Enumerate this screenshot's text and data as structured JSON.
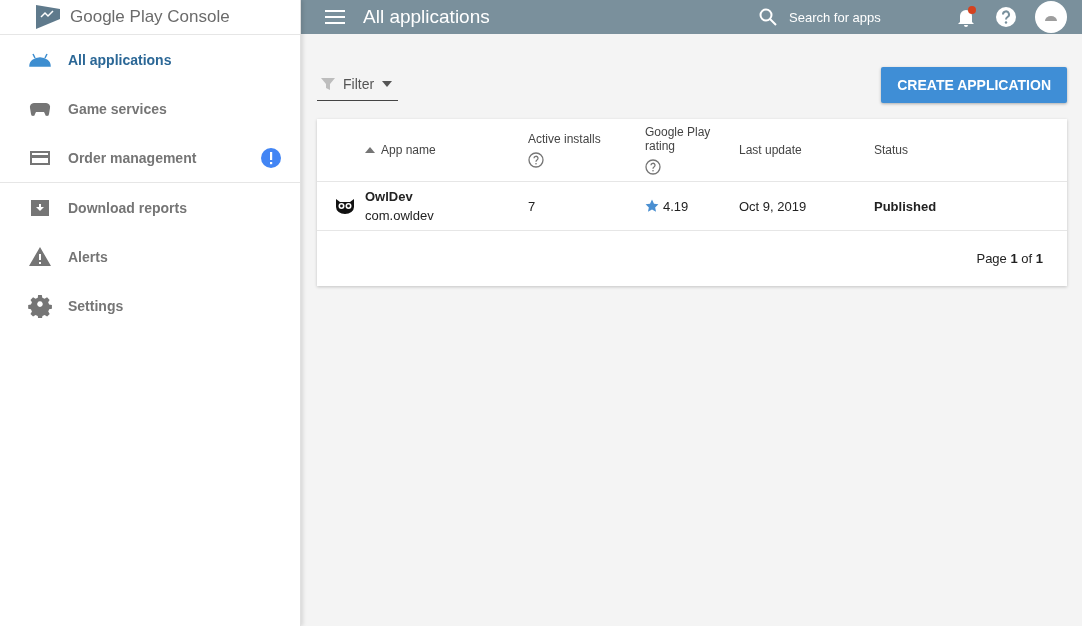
{
  "logo": {
    "text": "Google Play Console"
  },
  "sidebar": {
    "items": [
      {
        "label": "All applications",
        "kind": "android",
        "selected": true,
        "badge": false,
        "divider_after": false
      },
      {
        "label": "Game services",
        "kind": "gamepad",
        "selected": false,
        "badge": false,
        "divider_after": false
      },
      {
        "label": "Order management",
        "kind": "card",
        "selected": false,
        "badge": true,
        "divider_after": true
      },
      {
        "label": "Download reports",
        "kind": "download",
        "selected": false,
        "badge": false,
        "divider_after": false
      },
      {
        "label": "Alerts",
        "kind": "alert",
        "selected": false,
        "badge": false,
        "divider_after": false
      },
      {
        "label": "Settings",
        "kind": "gear",
        "selected": false,
        "badge": false,
        "divider_after": false
      }
    ]
  },
  "topbar": {
    "title": "All applications",
    "search_placeholder": "Search for apps",
    "notification": true
  },
  "filter": {
    "label": "Filter"
  },
  "create_button": "CREATE APPLICATION",
  "table": {
    "columns": [
      {
        "label": "App name",
        "sort": true,
        "help": false
      },
      {
        "label": "Active installs",
        "sort": false,
        "help": true
      },
      {
        "label": "Google Play rating",
        "sort": false,
        "help": true
      },
      {
        "label": "Last update",
        "sort": false,
        "help": false
      },
      {
        "label": "Status",
        "sort": false,
        "help": false
      }
    ],
    "rows": [
      {
        "name": "OwlDev",
        "package": "com.owldev",
        "installs": "7",
        "rating": "4.19",
        "updated": "Oct 9, 2019",
        "status": "Published"
      }
    ],
    "pagination": "Page **1** of **1**"
  }
}
